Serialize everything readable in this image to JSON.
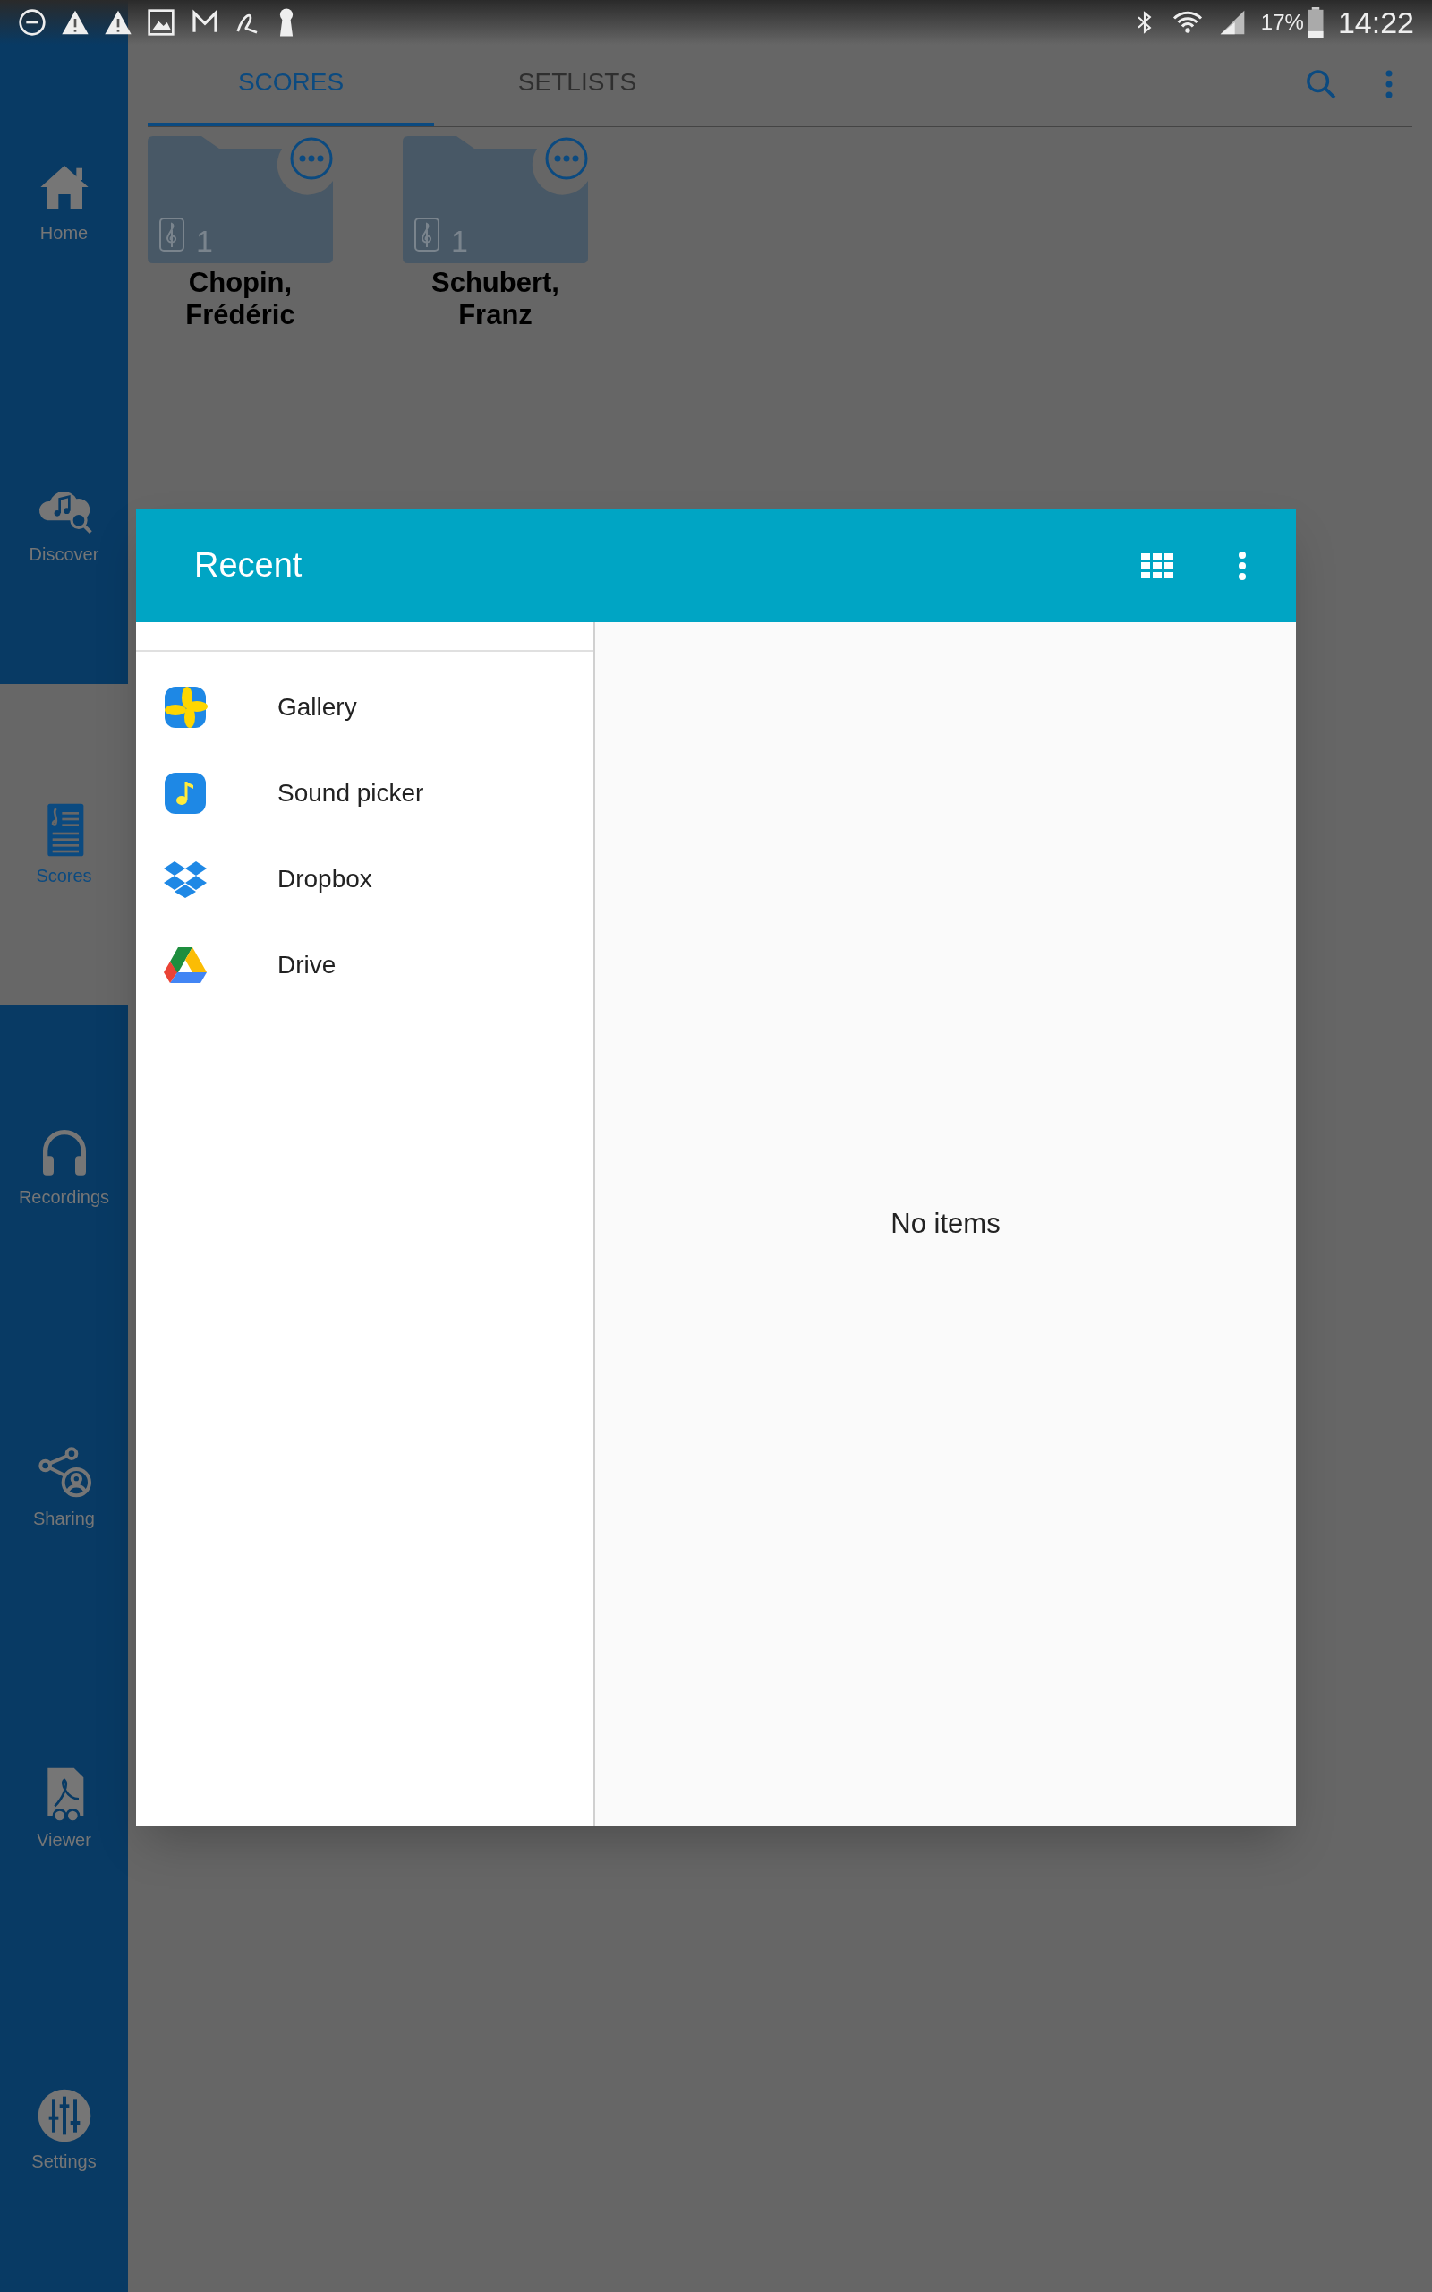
{
  "status_bar": {
    "battery": "17%",
    "time": "14:22"
  },
  "sidebar": {
    "items": [
      {
        "label": "Home",
        "selected": false
      },
      {
        "label": "Discover",
        "selected": false
      },
      {
        "label": "Scores",
        "selected": true
      },
      {
        "label": "Recordings",
        "selected": false
      },
      {
        "label": "Sharing",
        "selected": false
      },
      {
        "label": "Viewer",
        "selected": false
      },
      {
        "label": "Settings",
        "selected": false
      }
    ]
  },
  "tabs": [
    {
      "label": "SCORES",
      "selected": true
    },
    {
      "label": "SETLISTS",
      "selected": false
    }
  ],
  "folders": [
    {
      "name": "Chopin, Frédéric",
      "count": "1"
    },
    {
      "name": "Schubert, Franz",
      "count": "1"
    }
  ],
  "dialog": {
    "title": "Recent",
    "roots": [
      {
        "label": "Gallery"
      },
      {
        "label": "Sound picker"
      },
      {
        "label": "Dropbox"
      },
      {
        "label": "Drive"
      }
    ],
    "empty_message": "No items"
  }
}
